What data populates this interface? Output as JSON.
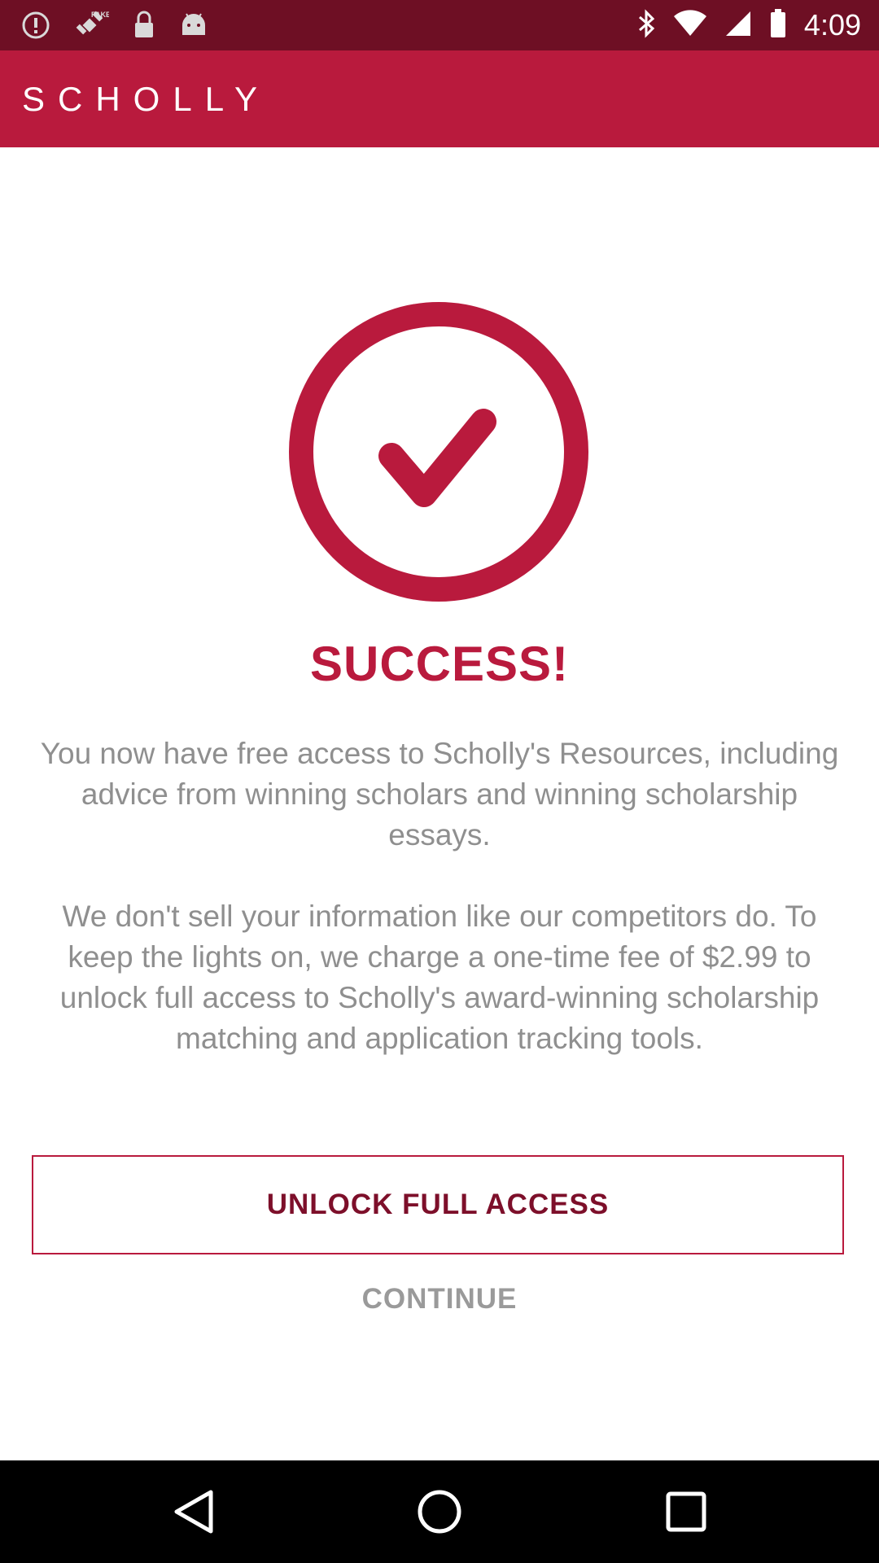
{
  "status_bar": {
    "time": "4:09",
    "left_icons": [
      "alert-icon",
      "fake-gps-icon",
      "lock-icon",
      "android-icon"
    ],
    "right_icons": [
      "bluetooth-icon",
      "wifi-icon",
      "signal-icon",
      "battery-icon"
    ]
  },
  "app_bar": {
    "title": "SCHOLLY"
  },
  "success": {
    "icon": "checkmark-circle-icon",
    "title": "SUCCESS!",
    "paragraph_1": "You now have free access to Scholly's Resources, including advice from winning scholars and winning scholarship essays.",
    "paragraph_2": "We don't sell your information like our competitors do. To keep the lights on, we charge a one-time fee of $2.99 to unlock full access to Scholly's award-winning scholarship matching and application tracking tools."
  },
  "actions": {
    "unlock_label": "UNLOCK FULL ACCESS",
    "continue_label": "CONTINUE"
  },
  "nav_bar": {
    "buttons": [
      "back-icon",
      "home-icon",
      "recents-icon"
    ]
  },
  "colors": {
    "status_bar": "#6e0f24",
    "brand": "#b91a3d",
    "button_text": "#7d0f2a",
    "body_text": "#8f8f8f",
    "nav_bar": "#000000"
  }
}
